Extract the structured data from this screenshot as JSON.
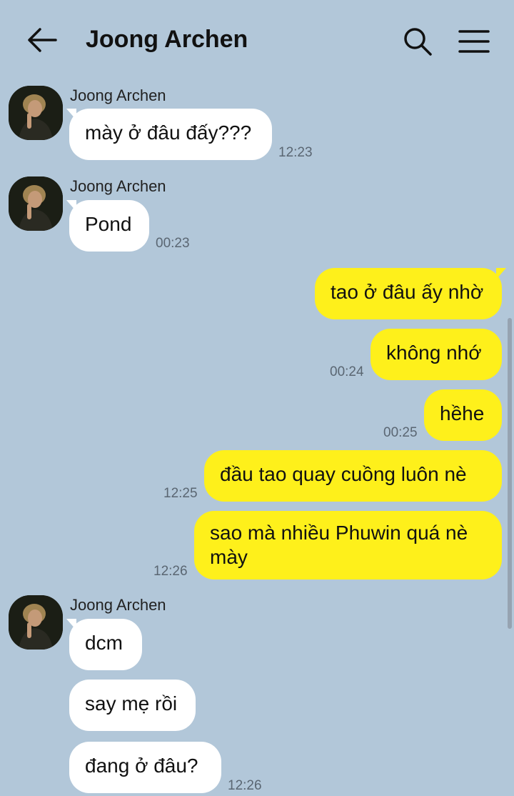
{
  "header": {
    "title": "Joong Archen",
    "back_icon": "arrow-left-icon",
    "search_icon": "search-icon",
    "menu_icon": "hamburger-menu-icon"
  },
  "colors": {
    "background": "#b2c7d9",
    "incoming_bubble": "#ffffff",
    "outgoing_bubble": "#fef01b"
  },
  "messages": [
    {
      "direction": "in",
      "sender": "Joong Archen",
      "text": "mày ở đâu đấy???",
      "time": "12:23"
    },
    {
      "direction": "in",
      "sender": "Joong Archen",
      "text": "Pond",
      "time": "00:23"
    },
    {
      "direction": "out",
      "text": "tao ở đâu ấy nhờ",
      "time": ""
    },
    {
      "direction": "out",
      "text": "không nhớ",
      "time": "00:24"
    },
    {
      "direction": "out",
      "text": "hềhe",
      "time": "00:25"
    },
    {
      "direction": "out",
      "text": "đầu tao quay cuồng luôn nè",
      "time": "12:25"
    },
    {
      "direction": "out",
      "text": "sao mà nhiều Phuwin quá nè mày",
      "line1": "sao mà nhiều Phuwin quá nè",
      "line2": "mày",
      "time": "12:26"
    },
    {
      "direction": "in",
      "sender": "Joong Archen",
      "text": "dcm",
      "time": ""
    },
    {
      "direction": "in",
      "text": "say mẹ rồi",
      "time": ""
    },
    {
      "direction": "in",
      "text": "đang ở đâu?",
      "time": "12:26"
    }
  ]
}
